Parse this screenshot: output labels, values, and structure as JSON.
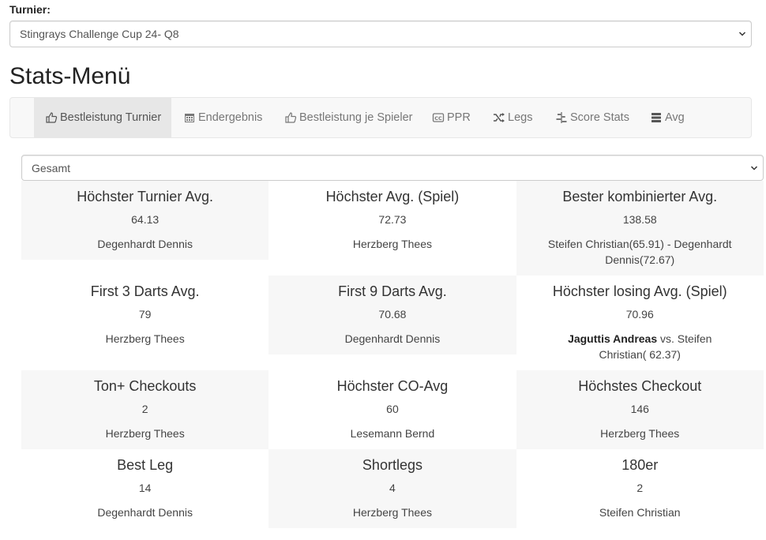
{
  "turnier": {
    "label": "Turnier:",
    "selected": "Stingrays Challenge Cup 24- Q8"
  },
  "title": "Stats-Menü",
  "nav": {
    "items": [
      {
        "label": "Bestleistung Turnier",
        "icon": "thumbs-up-icon"
      },
      {
        "label": "Endergebnis",
        "icon": "calendar-icon"
      },
      {
        "label": "Bestleistung je Spieler",
        "icon": "thumbs-up-icon"
      },
      {
        "label": "PPR",
        "icon": "cc-icon"
      },
      {
        "label": "Legs",
        "icon": "shuffle-icon"
      },
      {
        "label": "Score Stats",
        "icon": "align-icon"
      },
      {
        "label": "Avg",
        "icon": "list-icon"
      }
    ],
    "active_index": 0
  },
  "filter": {
    "selected": "Gesamt"
  },
  "stats": [
    [
      {
        "title": "Höchster Turnier Avg.",
        "value": "64.13",
        "player": "Degenhardt Dennis"
      },
      {
        "title": "Höchster Avg. (Spiel)",
        "value": "72.73",
        "player": "Herzberg Thees"
      },
      {
        "title": "Bester kombinierter Avg.",
        "value": "138.58",
        "player": "Steifen Christian(65.91) - Degenhardt Dennis(72.67)"
      }
    ],
    [
      {
        "title": "First 3 Darts Avg.",
        "value": "79",
        "player": "Herzberg Thees"
      },
      {
        "title": "First 9 Darts Avg.",
        "value": "70.68",
        "player": "Degenhardt Dennis"
      },
      {
        "title": "Höchster losing Avg. (Spiel)",
        "value": "70.96",
        "player_bold": "Jaguttis Andreas",
        "player": " vs. Steifen Christian( 62.37)"
      }
    ],
    [
      {
        "title": "Ton+ Checkouts",
        "value": "2",
        "player": "Herzberg Thees"
      },
      {
        "title": "Höchster CO-Avg",
        "value": "60",
        "player": "Lesemann Bernd"
      },
      {
        "title": "Höchstes Checkout",
        "value": "146",
        "player": "Herzberg Thees"
      }
    ],
    [
      {
        "title": "Best Leg",
        "value": "14",
        "player": "Degenhardt Dennis"
      },
      {
        "title": "Shortlegs",
        "value": "4",
        "player": "Herzberg Thees"
      },
      {
        "title": "180er",
        "value": "2",
        "player": "Steifen Christian"
      }
    ]
  ]
}
